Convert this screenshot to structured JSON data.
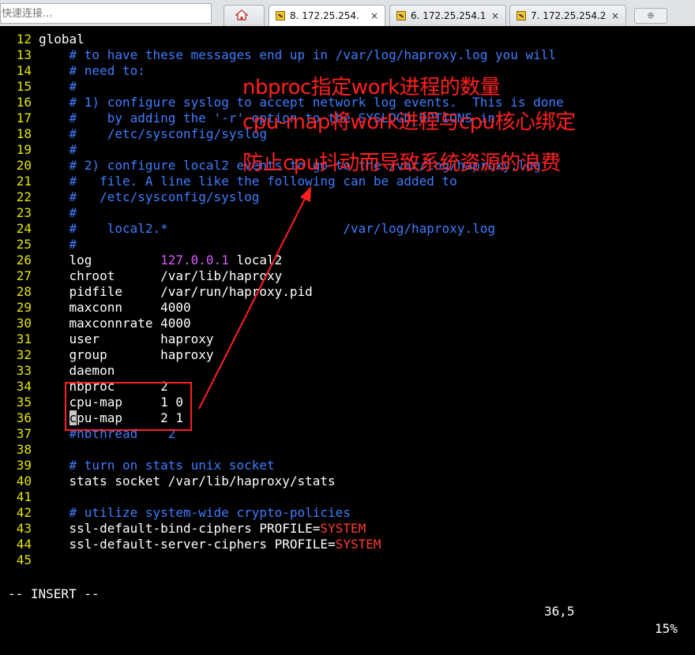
{
  "quick_connect": {
    "placeholder": "快速连接..."
  },
  "tabs": [
    {
      "label": "8. 172.25.254.",
      "close": "×",
      "active": true
    },
    {
      "label": "6. 172.25.254.1",
      "close": "×",
      "active": false
    },
    {
      "label": "7. 172.25.254.2",
      "close": "×",
      "active": false
    }
  ],
  "new_tab": {
    "glyph": "⊕"
  },
  "editor": {
    "lines": [
      {
        "n": "12",
        "parts": [
          [
            "plain",
            "global"
          ]
        ]
      },
      {
        "n": "13",
        "parts": [
          [
            "cmt",
            "    # to have these messages end up in /var/log/haproxy.log you will"
          ]
        ]
      },
      {
        "n": "14",
        "parts": [
          [
            "cmt",
            "    # need to:"
          ]
        ]
      },
      {
        "n": "15",
        "parts": [
          [
            "cmt",
            "    #"
          ]
        ]
      },
      {
        "n": "16",
        "parts": [
          [
            "cmt",
            "    # 1) configure syslog to accept network log events.  This is done"
          ]
        ]
      },
      {
        "n": "17",
        "parts": [
          [
            "cmt",
            "    #    by adding the '-r' option to the SYSLOGD_OPTIONS in"
          ]
        ]
      },
      {
        "n": "18",
        "parts": [
          [
            "cmt",
            "    #    /etc/sysconfig/syslog"
          ]
        ]
      },
      {
        "n": "19",
        "parts": [
          [
            "cmt",
            "    #"
          ]
        ]
      },
      {
        "n": "20",
        "parts": [
          [
            "cmt",
            "    # 2) configure local2 events to go to the /var/log/haproxy.log"
          ]
        ]
      },
      {
        "n": "21",
        "parts": [
          [
            "cmt",
            "    #   file. A line like the following can be added to"
          ]
        ]
      },
      {
        "n": "22",
        "parts": [
          [
            "cmt",
            "    #   /etc/sysconfig/syslog"
          ]
        ]
      },
      {
        "n": "23",
        "parts": [
          [
            "cmt",
            "    #"
          ]
        ]
      },
      {
        "n": "24",
        "parts": [
          [
            "cmt",
            "    #    local2.*                       /var/log/haproxy.log"
          ]
        ]
      },
      {
        "n": "25",
        "parts": [
          [
            "cmt",
            "    #"
          ]
        ]
      },
      {
        "n": "26",
        "parts": [
          [
            "plain",
            "    log         "
          ],
          [
            "num",
            "127.0.0.1"
          ],
          [
            "plain",
            " local2"
          ]
        ]
      },
      {
        "n": "27",
        "parts": [
          [
            "plain",
            "    chroot      /var/lib/haproxy"
          ]
        ]
      },
      {
        "n": "28",
        "parts": [
          [
            "plain",
            "    pidfile     /var/run/haproxy.pid"
          ]
        ]
      },
      {
        "n": "29",
        "parts": [
          [
            "plain",
            "    maxconn     4000"
          ]
        ]
      },
      {
        "n": "30",
        "parts": [
          [
            "plain",
            "    maxconnrate 4000"
          ]
        ]
      },
      {
        "n": "31",
        "parts": [
          [
            "plain",
            "    user        haproxy"
          ]
        ]
      },
      {
        "n": "32",
        "parts": [
          [
            "plain",
            "    group       haproxy"
          ]
        ]
      },
      {
        "n": "33",
        "parts": [
          [
            "plain",
            "    daemon"
          ]
        ]
      },
      {
        "n": "34",
        "parts": [
          [
            "plain",
            "    nbproc      2"
          ]
        ]
      },
      {
        "n": "35",
        "parts": [
          [
            "plain",
            "    cpu-map     1 0"
          ]
        ]
      },
      {
        "n": "36",
        "parts": [
          [
            "plain",
            "    "
          ],
          [
            "cursor",
            "c"
          ],
          [
            "plain",
            "pu-map     2 1"
          ]
        ]
      },
      {
        "n": "37",
        "parts": [
          [
            "cmt",
            "    #nbthread    2"
          ]
        ]
      },
      {
        "n": "38",
        "parts": [
          [
            "plain",
            ""
          ]
        ]
      },
      {
        "n": "39",
        "parts": [
          [
            "cmt",
            "    # turn on stats unix socket"
          ]
        ]
      },
      {
        "n": "40",
        "parts": [
          [
            "plain",
            "    stats socket /var/lib/haproxy/stats"
          ]
        ]
      },
      {
        "n": "41",
        "parts": [
          [
            "plain",
            ""
          ]
        ]
      },
      {
        "n": "42",
        "parts": [
          [
            "cmt",
            "    # utilize system-wide crypto-policies"
          ]
        ]
      },
      {
        "n": "43",
        "parts": [
          [
            "plain",
            "    ssl-default-bind-ciphers PROFILE="
          ],
          [
            "sys",
            "SYSTEM"
          ]
        ]
      },
      {
        "n": "44",
        "parts": [
          [
            "plain",
            "    ssl-default-server-ciphers PROFILE="
          ],
          [
            "sys",
            "SYSTEM"
          ]
        ]
      },
      {
        "n": "45",
        "parts": [
          [
            "plain",
            ""
          ]
        ]
      }
    ]
  },
  "status": {
    "mode": "-- INSERT --",
    "position": "36,5",
    "percent": "15%"
  },
  "annotations": [
    "nbproc指定work进程的数量",
    "cpu-map将work进程与cpu核心绑定",
    "防止cpu抖动而导致系统资源的浪费"
  ],
  "colors": {
    "annotation": "#ff2020",
    "comment": "#3f7dff",
    "line_number": "#e4e400",
    "number": "#d85cff",
    "keyword_system": "#ff3b30"
  }
}
